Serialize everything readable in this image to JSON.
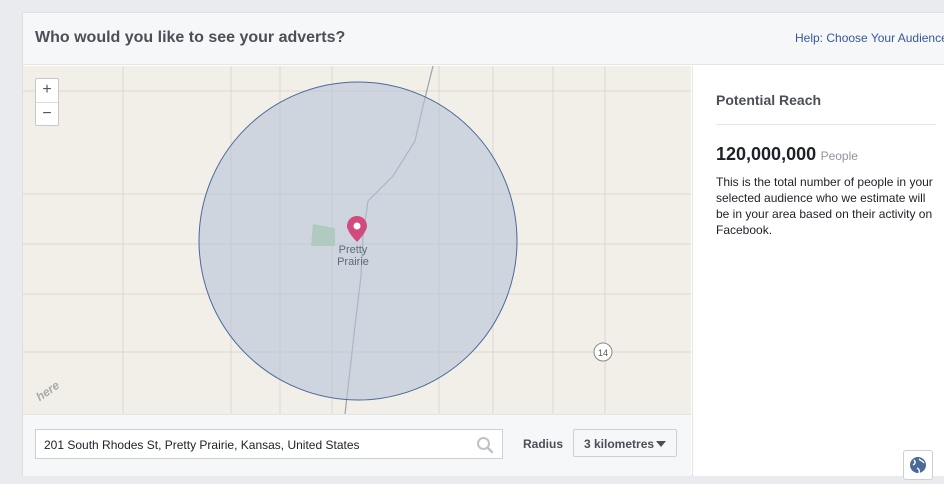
{
  "header": {
    "title": "Who would you like to see your adverts?",
    "help_link": "Help: Choose Your Audience"
  },
  "map": {
    "zoom_in": "+",
    "zoom_out": "−",
    "place_label_line1": "Pretty",
    "place_label_line2": "Prairie",
    "highway_badge": "14",
    "provider_logo": "here"
  },
  "search": {
    "value": "201 South Rhodes St, Pretty Prairie, Kansas, United States",
    "radius_label": "Radius",
    "radius_value": "3 kilometres"
  },
  "reach": {
    "title": "Potential Reach",
    "number": "120,000,000",
    "unit": "People",
    "description": "This is the total number of people in your selected audience who we estimate will be in your area based on their activity on Facebook."
  },
  "colors": {
    "accent_link": "#365899",
    "pin": "#d14b7c",
    "circle_fill": "#b7c3d7",
    "circle_stroke": "#4a6a9a"
  }
}
